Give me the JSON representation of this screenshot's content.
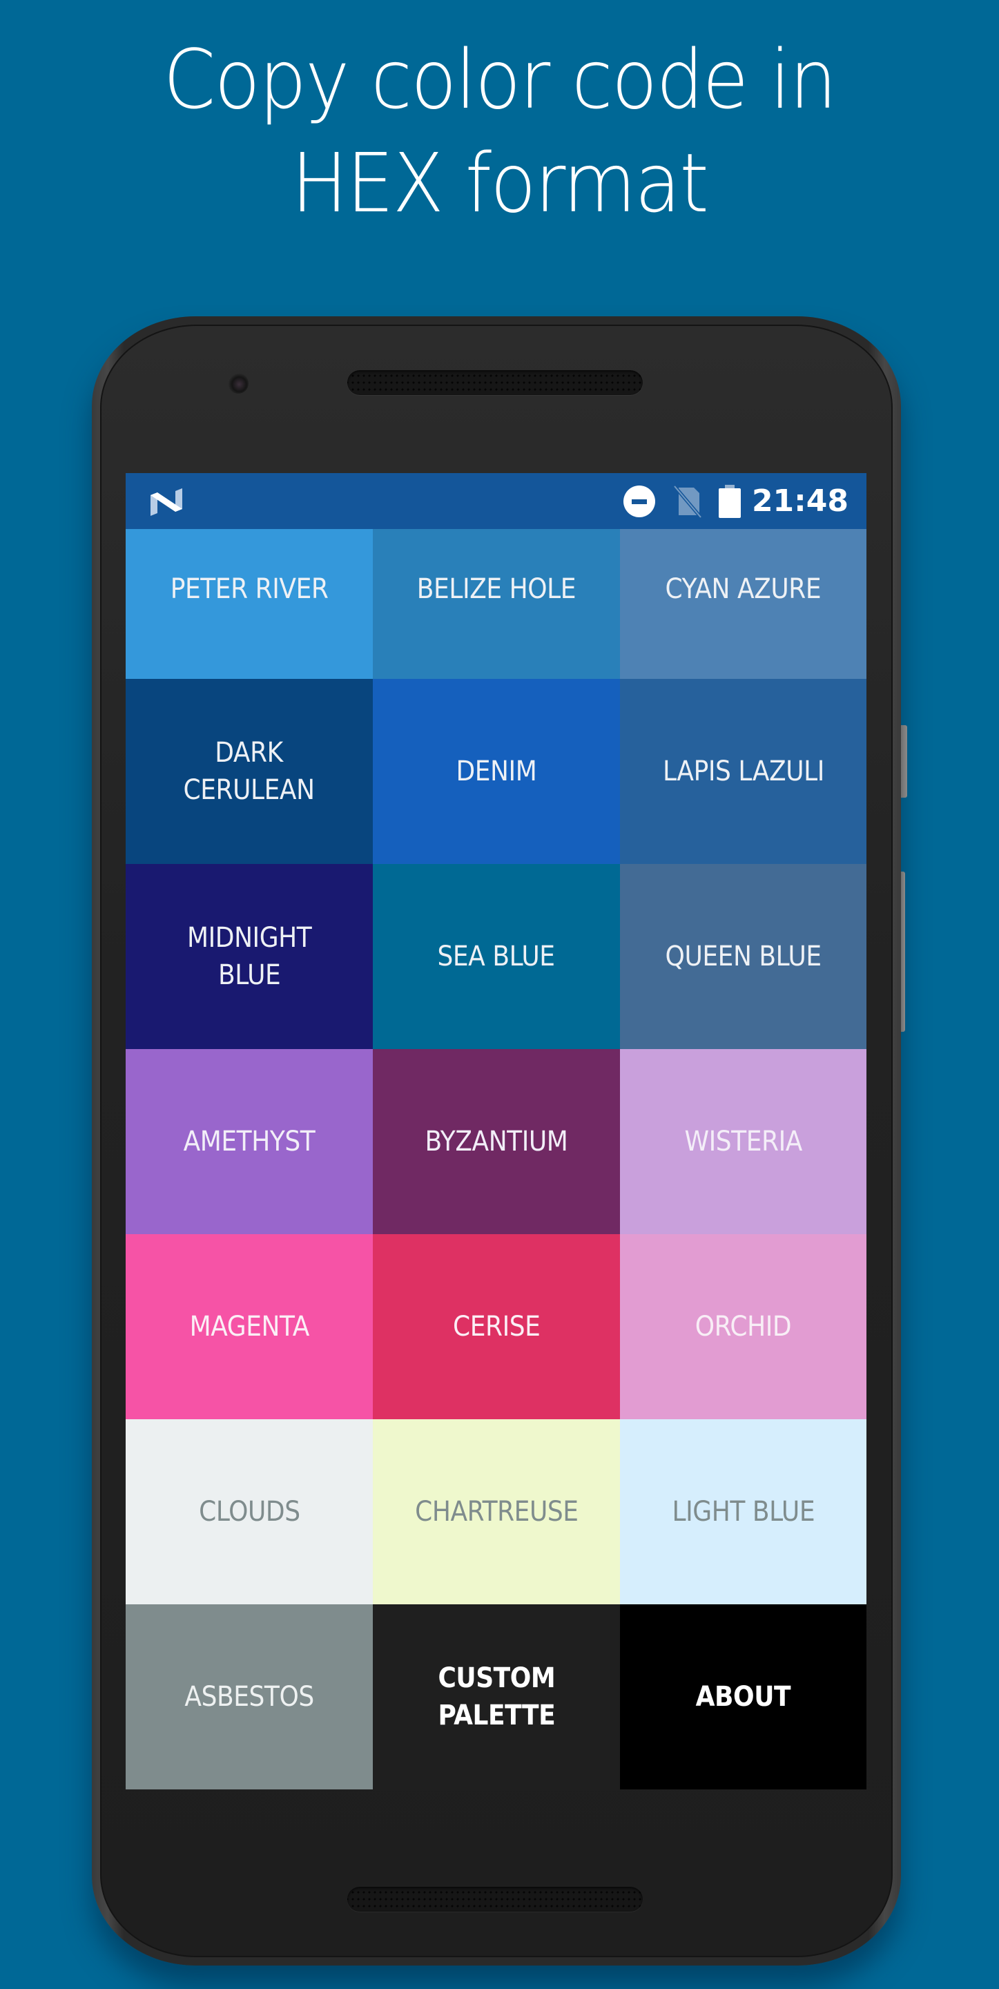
{
  "headline": {
    "line1": "Copy color code in",
    "line2": "HEX format"
  },
  "background_color": "#006896",
  "status_bar": {
    "logo": "android-nougat-logo",
    "icons": [
      "do-not-disturb-icon",
      "no-sim-icon",
      "battery-icon"
    ],
    "time": "21:48",
    "color": "#14569a"
  },
  "palette": [
    {
      "label": "PETER RIVER",
      "color": "#3498db",
      "text_color": "#eef1f5"
    },
    {
      "label": "BELIZE HOLE",
      "color": "#2980b9",
      "text_color": "#eef1f5"
    },
    {
      "label": "CYAN AZURE",
      "color": "#4e82b4",
      "text_color": "#eef1f5"
    },
    {
      "label": "DARK CERULEAN",
      "color": "#08457e",
      "text_color": "#eef1f5"
    },
    {
      "label": "DENIM",
      "color": "#1560bd",
      "text_color": "#eef1f5"
    },
    {
      "label": "LAPIS LAZULI",
      "color": "#26619c",
      "text_color": "#eef1f5"
    },
    {
      "label": "MIDNIGHT BLUE",
      "color": "#191970",
      "text_color": "#eef1f5"
    },
    {
      "label": "SEA BLUE",
      "color": "#006994",
      "text_color": "#eef1f5"
    },
    {
      "label": "QUEEN BLUE",
      "color": "#436b95",
      "text_color": "#eef1f5"
    },
    {
      "label": "AMETHYST",
      "color": "#9966cc",
      "text_color": "#f2eef8"
    },
    {
      "label": "BYZANTIUM",
      "color": "#702963",
      "text_color": "#f2eef8"
    },
    {
      "label": "WISTERIA",
      "color": "#c9a0dc",
      "text_color": "#f4eef8"
    },
    {
      "label": "MAGENTA",
      "color": "#f653a6",
      "text_color": "#fbeff6"
    },
    {
      "label": "CERISE",
      "color": "#de3163",
      "text_color": "#fbeff6"
    },
    {
      "label": "ORCHID",
      "color": "#e29cd2",
      "text_color": "#f8eef6"
    },
    {
      "label": "CLOUDS",
      "color": "#ecf0f1",
      "text_color": "#7f8c8d"
    },
    {
      "label": "CHARTREUSE",
      "color": "#eff8cd",
      "text_color": "#7f8c8d"
    },
    {
      "label": "LIGHT BLUE",
      "color": "#d6eefd",
      "text_color": "#7f8c8d"
    },
    {
      "label": "ASBESTOS",
      "color": "#7f8c8d",
      "text_color": "#eef1f1"
    },
    {
      "label": "CUSTOM PALETTE",
      "color": "#1f1f1f",
      "text_color": "#ffffff",
      "bold": true
    },
    {
      "label": "ABOUT",
      "color": "#000000",
      "text_color": "#ffffff",
      "bold": true
    }
  ]
}
